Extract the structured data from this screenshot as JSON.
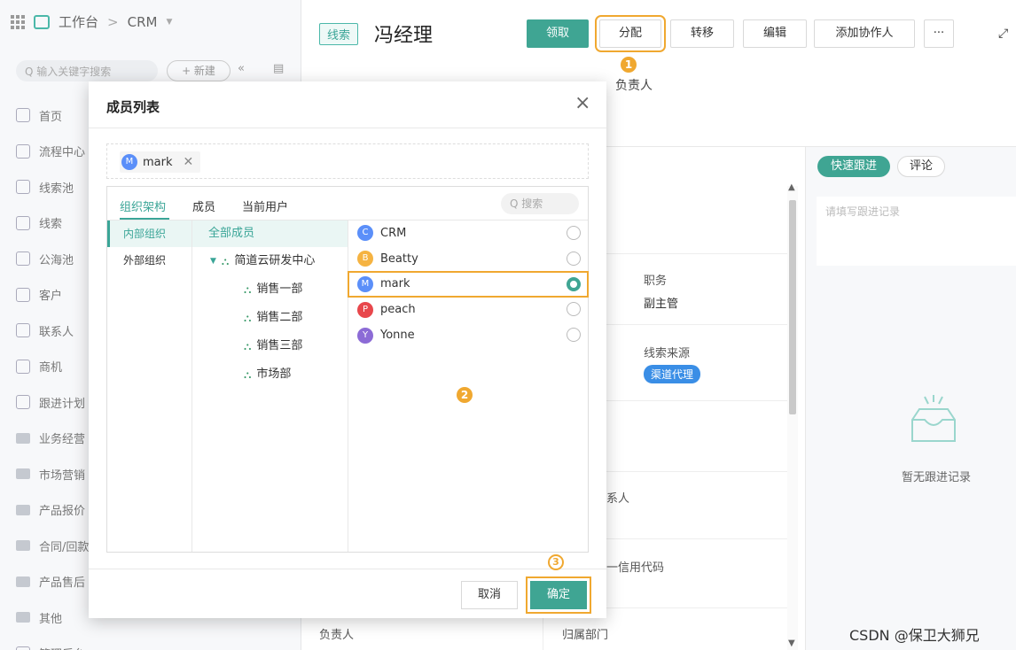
{
  "topbar": {
    "workspace": "工作台",
    "separator": ">",
    "module": "CRM",
    "module_caret": "▼"
  },
  "sidebar": {
    "search_placeholder": "Q 输入关键字搜索",
    "new_label": "+ 新建",
    "collapse_label": "«",
    "items": [
      {
        "label": "首页",
        "icon": "home-icon"
      },
      {
        "label": "流程中心",
        "icon": "flow-icon"
      },
      {
        "label": "线索池",
        "icon": "pool-icon"
      },
      {
        "label": "线索",
        "icon": "lead-icon"
      },
      {
        "label": "公海池",
        "icon": "public-pool-icon"
      },
      {
        "label": "客户",
        "icon": "customer-icon"
      },
      {
        "label": "联系人",
        "icon": "contact-icon"
      },
      {
        "label": "商机",
        "icon": "opportunity-icon"
      },
      {
        "label": "跟进计划",
        "icon": "plan-icon"
      },
      {
        "label": "业务经营",
        "icon": "folder-icon"
      },
      {
        "label": "市场营销",
        "icon": "folder-icon"
      },
      {
        "label": "产品报价",
        "icon": "folder-icon"
      },
      {
        "label": "合同/回款",
        "icon": "folder-icon"
      },
      {
        "label": "产品售后",
        "icon": "folder-icon"
      },
      {
        "label": "其他",
        "icon": "folder-icon"
      },
      {
        "label": "管理后台",
        "icon": "settings-icon"
      }
    ]
  },
  "header": {
    "tag": "线索",
    "name": "冯经理",
    "buttons": {
      "claim": "领取",
      "assign": "分配",
      "transfer": "转移",
      "edit": "编辑",
      "add_collaborator": "添加协作人",
      "more": "···"
    },
    "owner_label": "负责人",
    "steps": {
      "one": "1",
      "two": "2",
      "three": "3"
    }
  },
  "detail": {
    "position_label": "职务",
    "position_value": "副主管",
    "source_label": "线索来源",
    "source_value": "渠道代理",
    "contact_label": "系人",
    "credit_label": "一信用代码",
    "owner_label": "负责人",
    "dept_label": "归属部门"
  },
  "right_panel": {
    "tab_active": "快速跟进",
    "tab_comment": "评论",
    "input_placeholder": "请填写跟进记录",
    "empty_text": "暂无跟进记录"
  },
  "watermark": "CSDN @保卫大狮兄",
  "modal": {
    "title": "成员列表",
    "close": "×",
    "selected": [
      {
        "name": "mark",
        "initial": "M",
        "color": "#5b8ff9"
      }
    ],
    "tabs": {
      "org": "组织架构",
      "members": "成员",
      "current": "当前用户"
    },
    "search_placeholder": "Q 搜索",
    "org_types": {
      "internal": "内部组织",
      "external": "外部组织"
    },
    "all_members": "全部成员",
    "tree": {
      "root": "简道云研发中心",
      "children": [
        "销售一部",
        "销售二部",
        "销售三部",
        "市场部"
      ]
    },
    "members": [
      {
        "name": "CRM",
        "initial": "C",
        "color": "#5b8ff9",
        "selected": false
      },
      {
        "name": "Beatty",
        "initial": "B",
        "color": "#f5b342",
        "selected": false
      },
      {
        "name": "mark",
        "initial": "M",
        "color": "#5b8ff9",
        "selected": true
      },
      {
        "name": "peach",
        "initial": "P",
        "color": "#e8474c",
        "selected": false
      },
      {
        "name": "Yonne",
        "initial": "Y",
        "color": "#8c6bd6",
        "selected": false
      }
    ],
    "cancel": "取消",
    "confirm": "确定"
  },
  "colors": {
    "primary": "#3fa593",
    "highlight": "#f0a830",
    "tag_blue": "#3a8ee6"
  }
}
